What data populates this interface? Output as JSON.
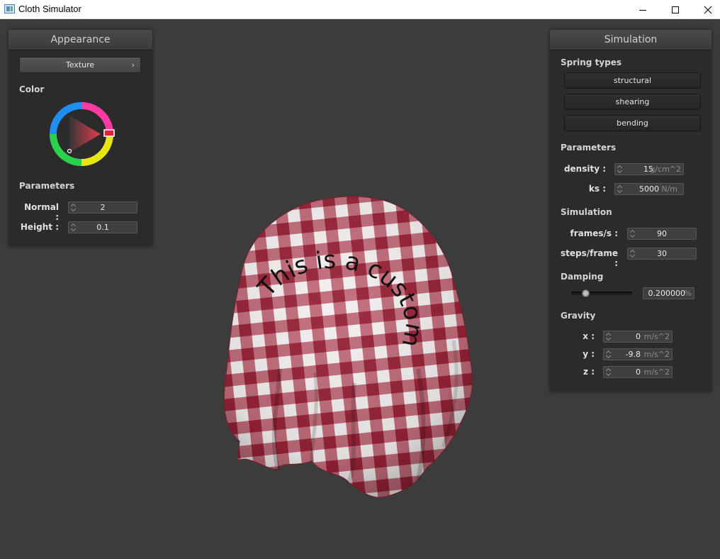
{
  "window": {
    "title": "Cloth Simulator"
  },
  "appearance": {
    "header": "Appearance",
    "texture_button": "Texture",
    "color_label": "Color",
    "parameters_label": "Parameters",
    "normal": {
      "label": "Normal :",
      "value": "2"
    },
    "height": {
      "label": "Height :",
      "value": "0.1"
    }
  },
  "simulation": {
    "header": "Simulation",
    "spring_types_label": "Spring types",
    "spring_buttons": [
      "structural",
      "shearing",
      "bending"
    ],
    "parameters_label": "Parameters",
    "density": {
      "label": "density :",
      "value": "15",
      "unit": "g/cm^2"
    },
    "ks": {
      "label": "ks :",
      "value": "5000",
      "unit": "N/m"
    },
    "simulation_label": "Simulation",
    "frames_per_s": {
      "label": "frames/s :",
      "value": "90"
    },
    "steps_per_frame": {
      "label": "steps/frame :",
      "value": "30"
    },
    "damping_label": "Damping",
    "damping": {
      "value": "0.200000",
      "unit": "%",
      "fraction": 0.2
    },
    "gravity_label": "Gravity",
    "gravity": [
      {
        "label": "x :",
        "value": "0",
        "unit": "m/s^2"
      },
      {
        "label": "y :",
        "value": "-9.8",
        "unit": "m/s^2"
      },
      {
        "label": "z :",
        "value": "0",
        "unit": "m/s^2"
      }
    ]
  },
  "cloth": {
    "texture_text": "This is a custom texture :)",
    "colors": {
      "check": "#a8303f",
      "light": "#f2efee"
    }
  },
  "colors": {
    "background": "#3c3c3c",
    "panel": "#2b2b2b"
  }
}
